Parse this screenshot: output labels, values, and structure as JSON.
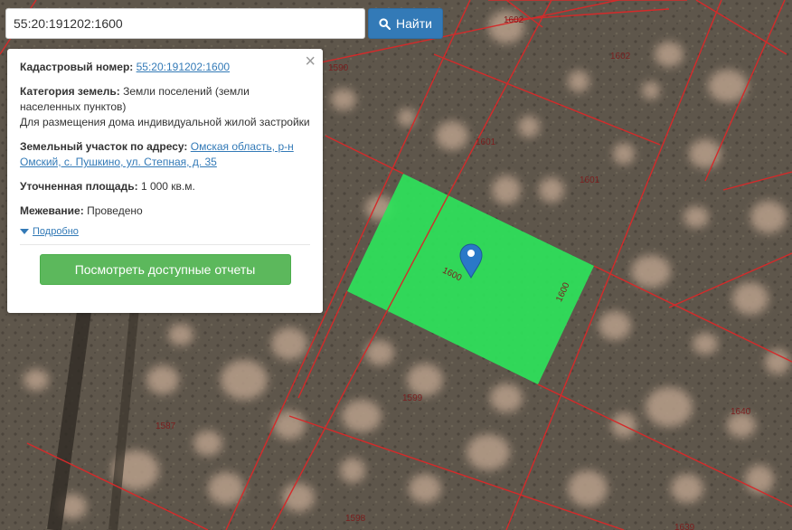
{
  "search": {
    "value": "55:20:191202:1600",
    "button_label": "Найти",
    "icon": "search-icon"
  },
  "popup": {
    "cadastral_label": "Кадастровый номер:",
    "cadastral_value": "55:20:191202:1600",
    "category_label": "Категория земель:",
    "category_value": "Земли поселений (земли населенных пунктов)",
    "usage_value": "Для размещения дома индивидуальной жилой застройки",
    "address_label": "Земельный участок по адресу:",
    "address_value": "Омская область, р-н Омский, с. Пушкино, ул. Степная, д. 35",
    "area_label": "Уточненная площадь:",
    "area_value": "1 000 кв.м.",
    "survey_label": "Межевание:",
    "survey_value": "Проведено",
    "details_link": "Подробно",
    "reports_button": "Посмотреть доступные отчеты",
    "close_icon": "close-icon"
  },
  "map": {
    "plot_labels": {
      "l1602a": "1602",
      "l1602b": "1602",
      "l1590": "1590",
      "l1601a": "1601",
      "l1601b": "1601",
      "l1600a": "1600",
      "l1600b": "1600",
      "l1599": "1599",
      "l1587": "1587",
      "l1640": "1640",
      "l1598": "1598",
      "l1639": "1639"
    },
    "colors": {
      "boundary": "#d42a2a",
      "selected_plot": "#2ee25a",
      "marker": "#2a78c8"
    }
  }
}
